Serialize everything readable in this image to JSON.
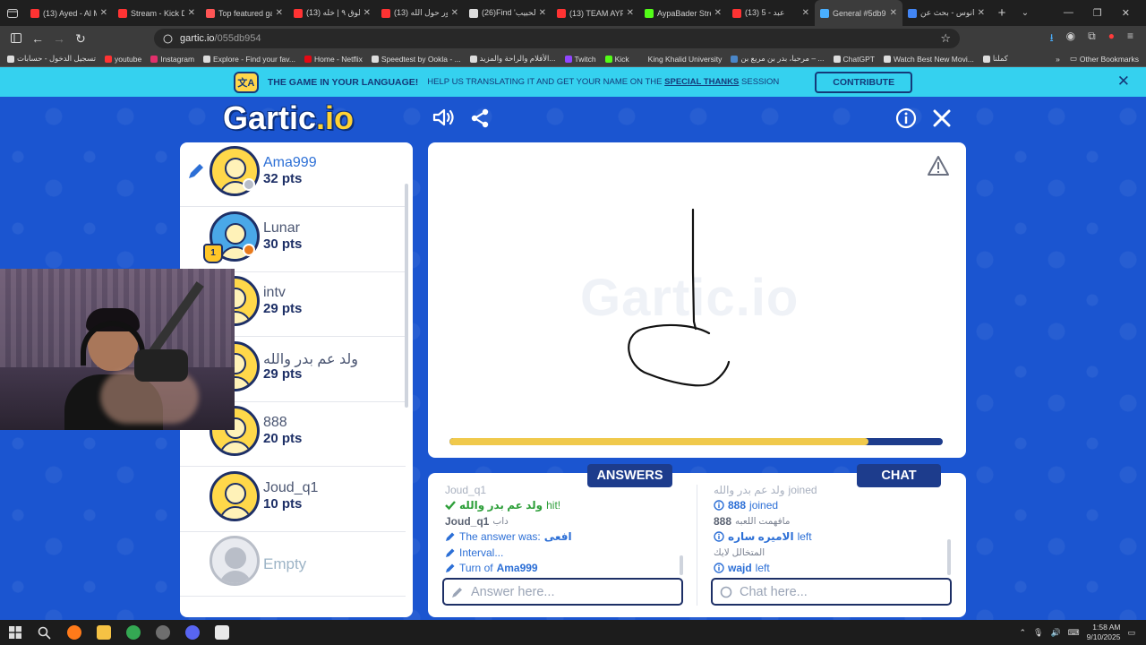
{
  "browser": {
    "tabs": [
      {
        "title": "(13) Ayed - Al M",
        "color": "#ff3333"
      },
      {
        "title": "Stream - Kick Da",
        "color": "#ff3333"
      },
      {
        "title": "Top featured gar",
        "color": "#ff5555"
      },
      {
        "title": "(13) فلوق ٩ | خله",
        "color": "#ff3333"
      },
      {
        "title": "(13) باور حول الله",
        "color": "#ff3333"
      },
      {
        "title": "(26)Find 'الحبيب'",
        "color": "#dddddd"
      },
      {
        "title": "(13) TEAM AYPA",
        "color": "#ff3333"
      },
      {
        "title": "AypaBader Strea",
        "color": "#53fc18"
      },
      {
        "title": "(13) 5 - عبد",
        "color": "#ff3333"
      },
      {
        "title": "General #5db95",
        "color": "#4ab0ff"
      },
      {
        "title": "فانوس - بحث عن",
        "color": "#4285f4"
      }
    ],
    "url_host": "gartic.io",
    "url_path": "/055db954",
    "bookmarks": [
      {
        "label": "تسجيل الدخول - حسابات",
        "color": "#dddddd"
      },
      {
        "label": "youtube",
        "color": "#ff3333"
      },
      {
        "label": "Instagram",
        "color": "#e1306c"
      },
      {
        "label": "Explore - Find your fav...",
        "color": "#dddddd"
      },
      {
        "label": "Home - Netflix",
        "color": "#e50914"
      },
      {
        "label": "Speedtest by Ookla - ...",
        "color": "#dddddd"
      },
      {
        "label": "الأفلام والراحة والمزيد...",
        "color": "#dddddd"
      },
      {
        "label": "Twitch",
        "color": "#9146ff"
      },
      {
        "label": "Kick",
        "color": "#53fc18"
      },
      {
        "label": "King Khalid University",
        "color": "#3c3c3c"
      },
      {
        "label": "مرحبا، بدر بن مريع بن – ...",
        "color": "#4a86c8"
      },
      {
        "label": "ChatGPT",
        "color": "#dddddd"
      },
      {
        "label": "Watch Best New Movi...",
        "color": "#dddddd"
      },
      {
        "label": "كملنا",
        "color": "#dddddd"
      }
    ],
    "other_bookmarks": "Other Bookmarks"
  },
  "banner": {
    "icon_text": "文A",
    "headline": "THE GAME IN YOUR LANGUAGE!",
    "body_prefix": "HELP US TRANSLATING IT AND GET YOUR NAME ON THE",
    "body_link": "SPECIAL THANKS",
    "body_suffix": "SESSION",
    "cta": "CONTRIBUTE"
  },
  "logo": {
    "main": "Gartic",
    "suffix": ".io"
  },
  "players": [
    {
      "name": "Ama999",
      "points": "32 pts",
      "active": true,
      "status_color": "#b9bec8",
      "trophy": ""
    },
    {
      "name": "Lunar",
      "points": "30 pts",
      "active": false,
      "status_color": "#e87a1c",
      "trophy": "1"
    },
    {
      "name": "intv",
      "points": "29 pts",
      "active": false,
      "status_color": "",
      "trophy": ""
    },
    {
      "name": "ولد عم بدر والله",
      "points": "29 pts",
      "active": false,
      "status_color": "",
      "trophy": ""
    },
    {
      "name": "888",
      "points": "20 pts",
      "active": false,
      "status_color": "",
      "trophy": ""
    },
    {
      "name": "Joud_q1",
      "points": "10 pts",
      "active": false,
      "status_color": "",
      "trophy": ""
    },
    {
      "name": "Empty",
      "points": "",
      "active": false,
      "status_color": "",
      "trophy": ""
    }
  ],
  "canvas": {
    "watermark": "Gartic.io",
    "timer_fraction": 0.85
  },
  "answers": {
    "label": "ANSWERS",
    "placeholder": "Answer here...",
    "messages": [
      {
        "kind": "faded",
        "who": "Joud_q1",
        "text": ""
      },
      {
        "kind": "hit",
        "who": "ولد عم بدر والله",
        "text": "hit!"
      },
      {
        "kind": "user",
        "who": "Joud_q1",
        "text": "داب"
      },
      {
        "kind": "system",
        "who": "",
        "text": "The answer was:",
        "extra": "افعى"
      },
      {
        "kind": "system",
        "who": "",
        "text": "Interval...",
        "extra": ""
      },
      {
        "kind": "turn",
        "who": "Ama999",
        "text": "Turn of"
      }
    ]
  },
  "chat": {
    "label": "CHAT",
    "placeholder": "Chat here...",
    "messages": [
      {
        "kind": "faded",
        "who": "ولد عم بدر والله",
        "text": "joined"
      },
      {
        "kind": "joined",
        "who": "888",
        "text": "joined"
      },
      {
        "kind": "user",
        "who": "888",
        "text": "مافهمت اللعبه"
      },
      {
        "kind": "left",
        "who": "الاميره ساره",
        "text": "left"
      },
      {
        "kind": "usertext",
        "who": "",
        "text": "المتخالل لايك"
      },
      {
        "kind": "left",
        "who": "wajd",
        "text": "left"
      }
    ]
  },
  "taskbar": {
    "time": "1:58 AM",
    "date": "9/10/2025",
    "apps": [
      {
        "name": "firefox",
        "color": "#ff7a1a"
      },
      {
        "name": "explorer",
        "color": "#f5c244"
      },
      {
        "name": "chrome",
        "color": "#34a853"
      },
      {
        "name": "obs",
        "color": "#6e6e6e"
      },
      {
        "name": "discord",
        "color": "#5865f2"
      },
      {
        "name": "store",
        "color": "#e8e8e8"
      }
    ]
  }
}
